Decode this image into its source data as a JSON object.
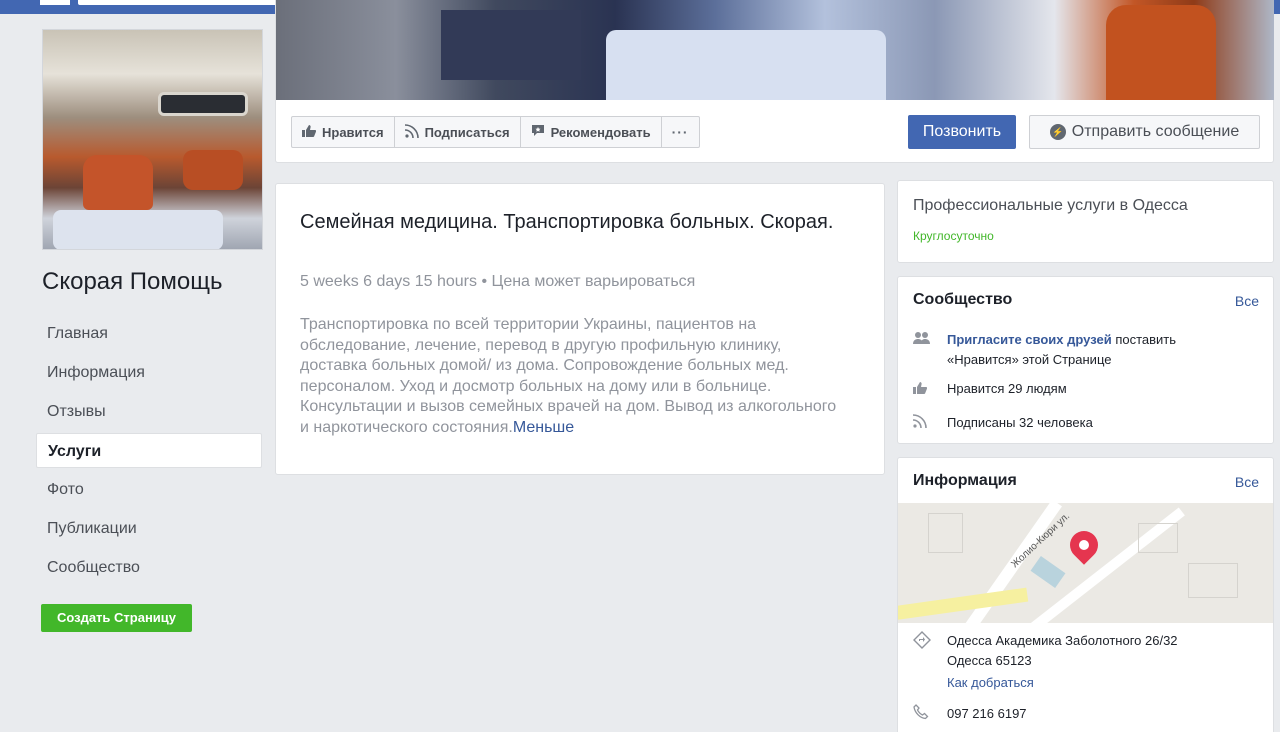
{
  "page": {
    "name": "Скорая Помощь"
  },
  "nav": {
    "items": [
      {
        "label": "Главная"
      },
      {
        "label": "Информация"
      },
      {
        "label": "Отзывы"
      },
      {
        "label": "Услуги"
      },
      {
        "label": "Фото"
      },
      {
        "label": "Публикации"
      },
      {
        "label": "Сообщество"
      }
    ],
    "active": "Услуги",
    "create_page": "Создать Страницу"
  },
  "actions": {
    "like": "Нравится",
    "follow": "Подписаться",
    "recommend": "Рекомендовать",
    "more": "···",
    "call": "Позвонить",
    "message": "Отправить сообщение"
  },
  "service": {
    "title": "Семейная медицина. Транспортировка больных. Скорая.",
    "meta": "5 weeks 6 days 15 hours • Цена может варьироваться",
    "description": "Транспортировка по всей территории Украины, пациентов на обследование, лечение, перевод в другую профильную клинику, доставка больных домой/ из дома. Сопровождение больных мед. персоналом. Уход и досмотр больных на дому или в больнице. Консультации и вызов семейных врачей на дом. Вывод из алкогольного и наркотического состояния.",
    "less": "Меньше"
  },
  "category": {
    "text": "Профессиональные услуги в Одесса",
    "hours": "Круглосуточно"
  },
  "community": {
    "title": "Сообщество",
    "all": "Все",
    "invite_link": "Пригласите своих друзей",
    "invite_rest": " поставить «Нравится» этой Странице",
    "likes": "Нравится 29 людям",
    "followers": "Подписаны 32 человека"
  },
  "info": {
    "title": "Информация",
    "all": "Все",
    "map_street": "Жолио-Кюри ул.",
    "address_line1": "Одесса Академика Заболотного 26/32",
    "address_line2": "Одесса 65123",
    "directions": "Как добраться",
    "phone": "097 216 6197"
  },
  "colors": {
    "brand": "#4267b2",
    "background": "#e9ebee",
    "green": "#42b72a",
    "link": "#365899"
  },
  "icons": [
    "like-icon",
    "rss-icon",
    "recommend-icon",
    "messenger-icon",
    "friends-icon",
    "map-pin-icon",
    "directions-icon",
    "phone-icon"
  ]
}
